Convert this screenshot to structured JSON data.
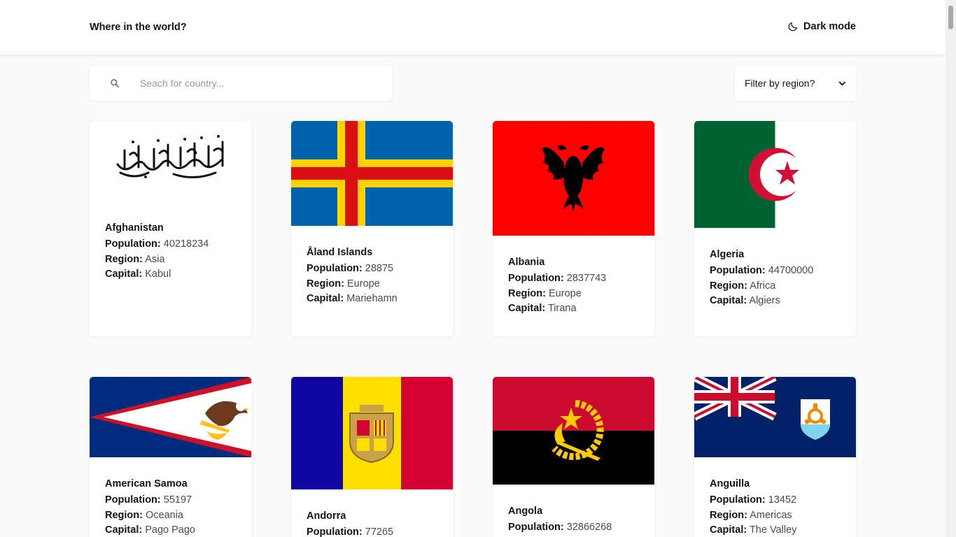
{
  "header": {
    "title": "Where in the world?",
    "dark_mode_label": "Dark mode"
  },
  "search": {
    "placeholder": "Seach for country..."
  },
  "filter": {
    "label": "Filter by region?"
  },
  "field_labels": {
    "population": "Population:",
    "region": "Region:",
    "capital": "Capital:"
  },
  "countries": [
    {
      "name": "Afghanistan",
      "population": "40218234",
      "region": "Asia",
      "capital": "Kabul"
    },
    {
      "name": "Åland Islands",
      "population": "28875",
      "region": "Europe",
      "capital": "Mariehamn"
    },
    {
      "name": "Albania",
      "population": "2837743",
      "region": "Europe",
      "capital": "Tirana"
    },
    {
      "name": "Algeria",
      "population": "44700000",
      "region": "Africa",
      "capital": "Algiers"
    },
    {
      "name": "American Samoa",
      "population": "55197",
      "region": "Oceania",
      "capital": "Pago Pago"
    },
    {
      "name": "Andorra",
      "population": "77265",
      "region": "",
      "capital": ""
    },
    {
      "name": "Angola",
      "population": "32866268",
      "region": "",
      "capital": ""
    },
    {
      "name": "Anguilla",
      "population": "13452",
      "region": "Americas",
      "capital": "The Valley"
    }
  ],
  "icons": {
    "dark_mode": "moon-icon",
    "search": "search-icon",
    "filter": "chevron-down-icon"
  }
}
